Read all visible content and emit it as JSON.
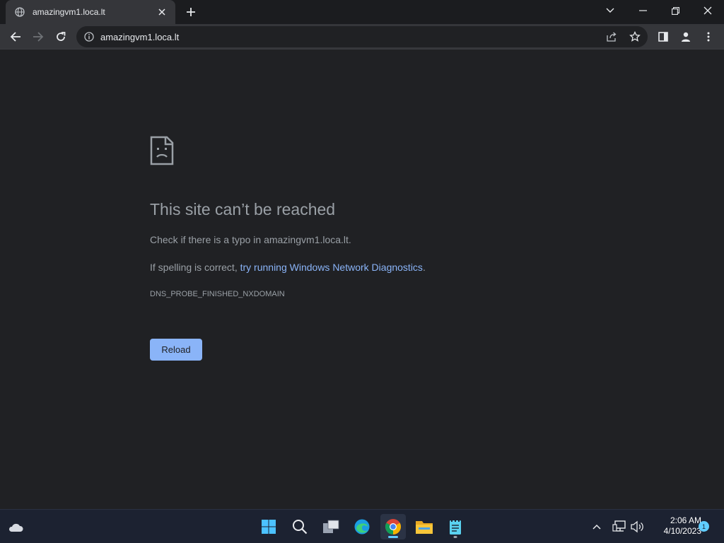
{
  "browser": {
    "tab": {
      "title": "amazingvm1.loca.lt"
    },
    "address": {
      "url": "amazingvm1.loca.lt"
    }
  },
  "error_page": {
    "heading": "This site can’t be reached",
    "typo_text": "Check if there is a typo in amazingvm1.loca.lt.",
    "spelling_prefix": "If spelling is correct, ",
    "diagnostics_link": "try running Windows Network Diagnostics",
    "spelling_suffix": ".",
    "error_code": "DNS_PROBE_FINISHED_NXDOMAIN",
    "reload_label": "Reload"
  },
  "taskbar": {
    "time": "2:06 AM",
    "date": "4/10/2023",
    "notification_count": "1",
    "apps": [
      "start-icon",
      "search-icon",
      "task-view-icon",
      "edge-icon",
      "chrome-icon",
      "file-explorer-icon",
      "notepad-icon"
    ]
  },
  "colors": {
    "page_bg": "#202124",
    "link": "#8ab4f8",
    "text_secondary": "#9aa0a6",
    "button_bg": "#8ab4f8",
    "taskbar_accent": "#60cdff"
  }
}
